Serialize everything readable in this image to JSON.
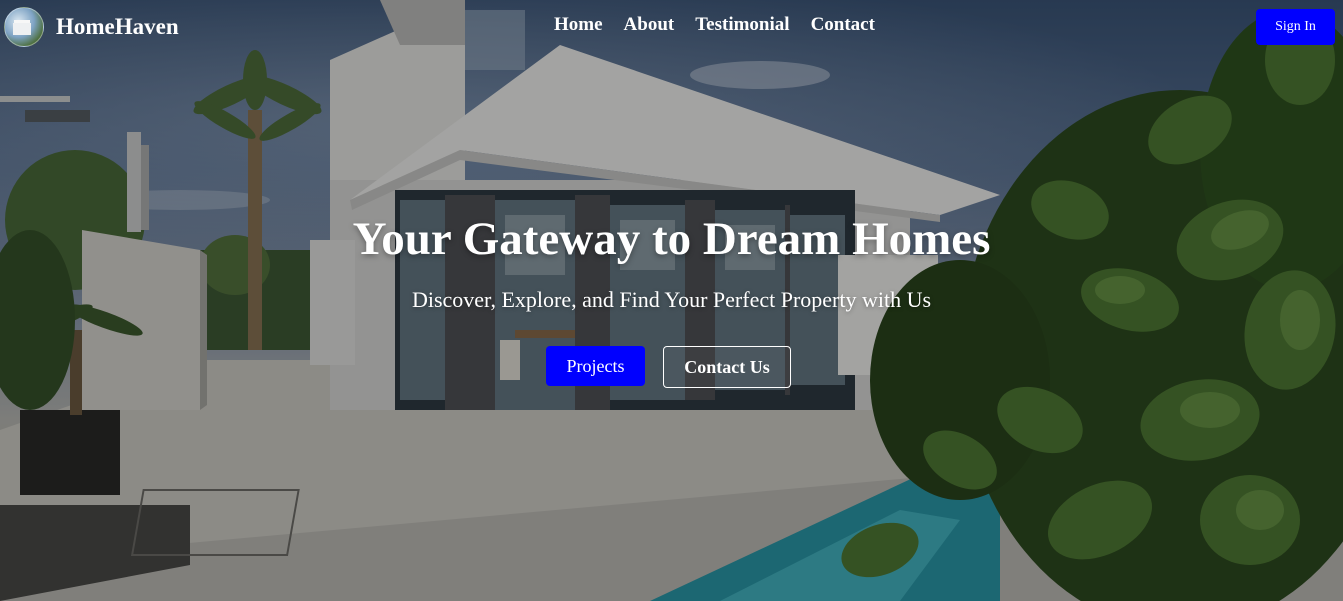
{
  "navbar": {
    "brand": "HomeHaven",
    "links": [
      "Home",
      "About",
      "Testimonial",
      "Contact"
    ],
    "signin_label": "Sign In"
  },
  "hero": {
    "headline": "Your Gateway to Dream Homes",
    "subheadline": "Discover, Explore, and Find Your Perfect Property with Us",
    "primary_button": "Projects",
    "secondary_button": "Contact Us"
  },
  "colors": {
    "accent": "#0000ff",
    "text": "#ffffff"
  }
}
